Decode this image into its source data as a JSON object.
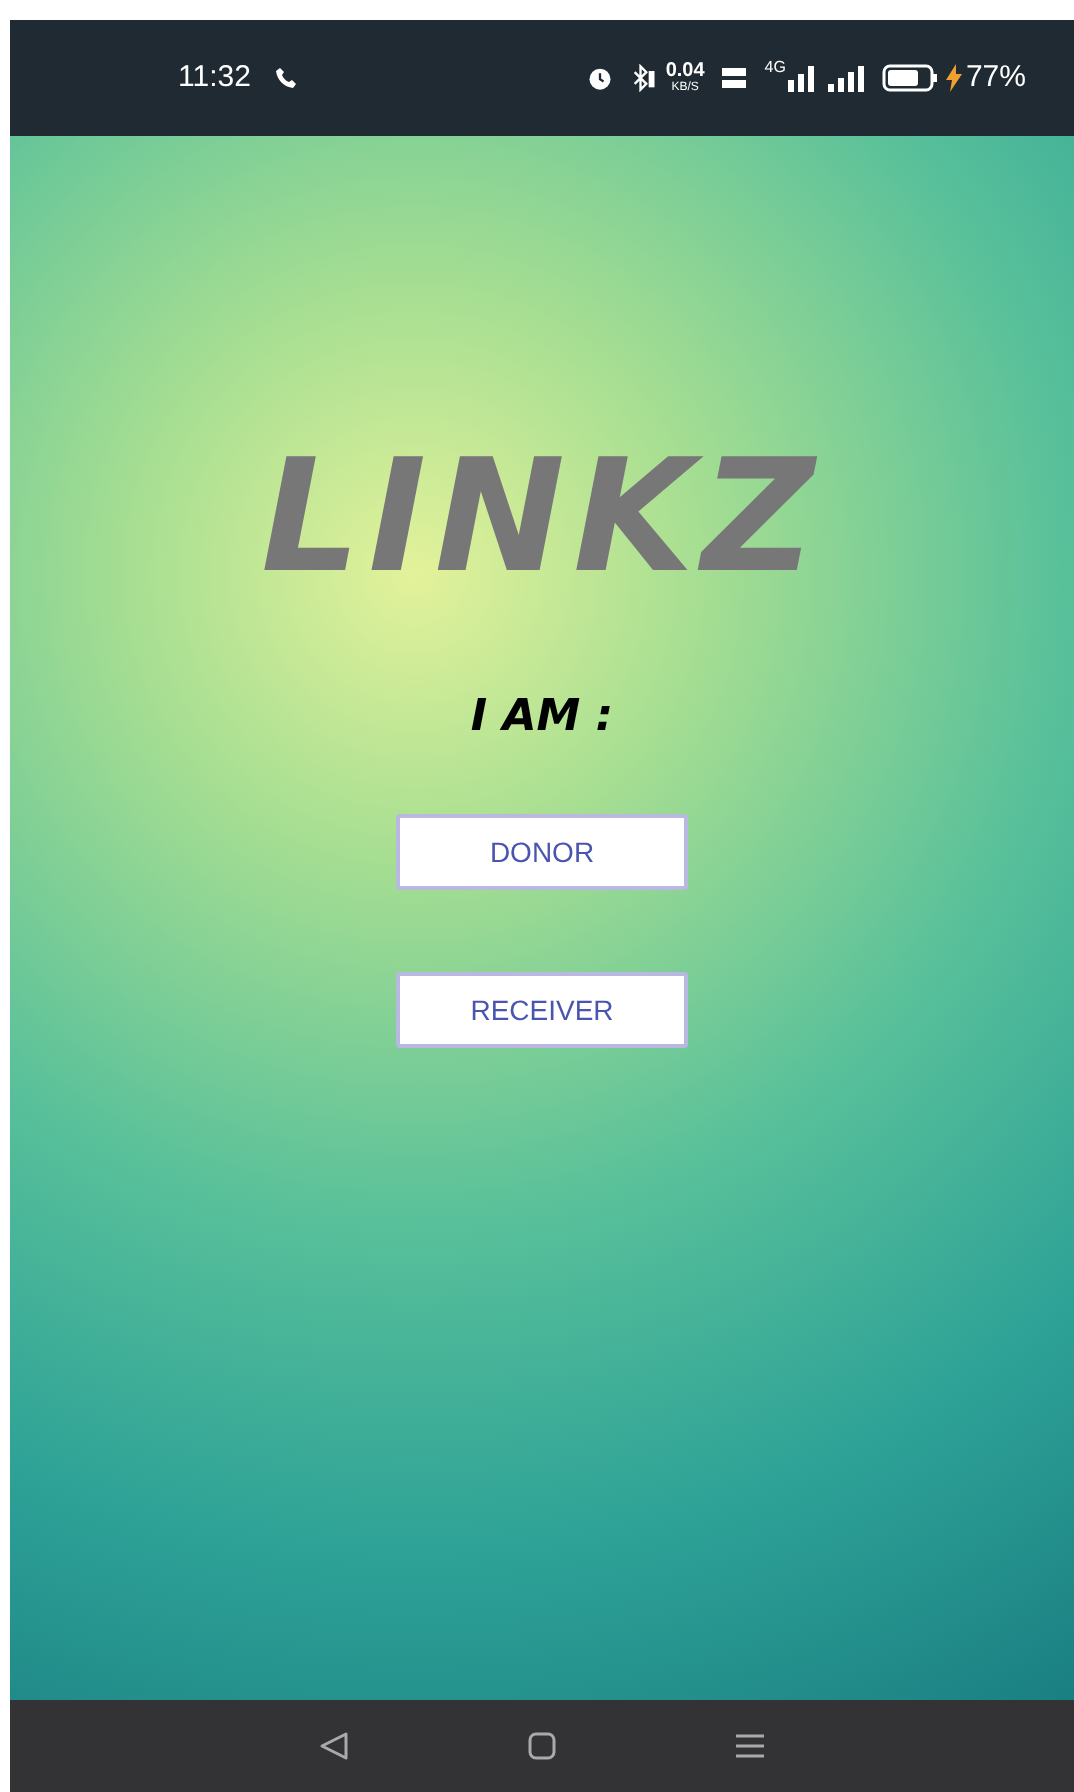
{
  "status_bar": {
    "time": "11:32",
    "speed": "0.04",
    "speed_unit": "KB/S",
    "network": "4G",
    "battery": "77%"
  },
  "app": {
    "logo": "LINKZ",
    "prompt": "I AM :",
    "buttons": [
      {
        "label": "DONOR"
      },
      {
        "label": "RECEIVER"
      }
    ]
  }
}
